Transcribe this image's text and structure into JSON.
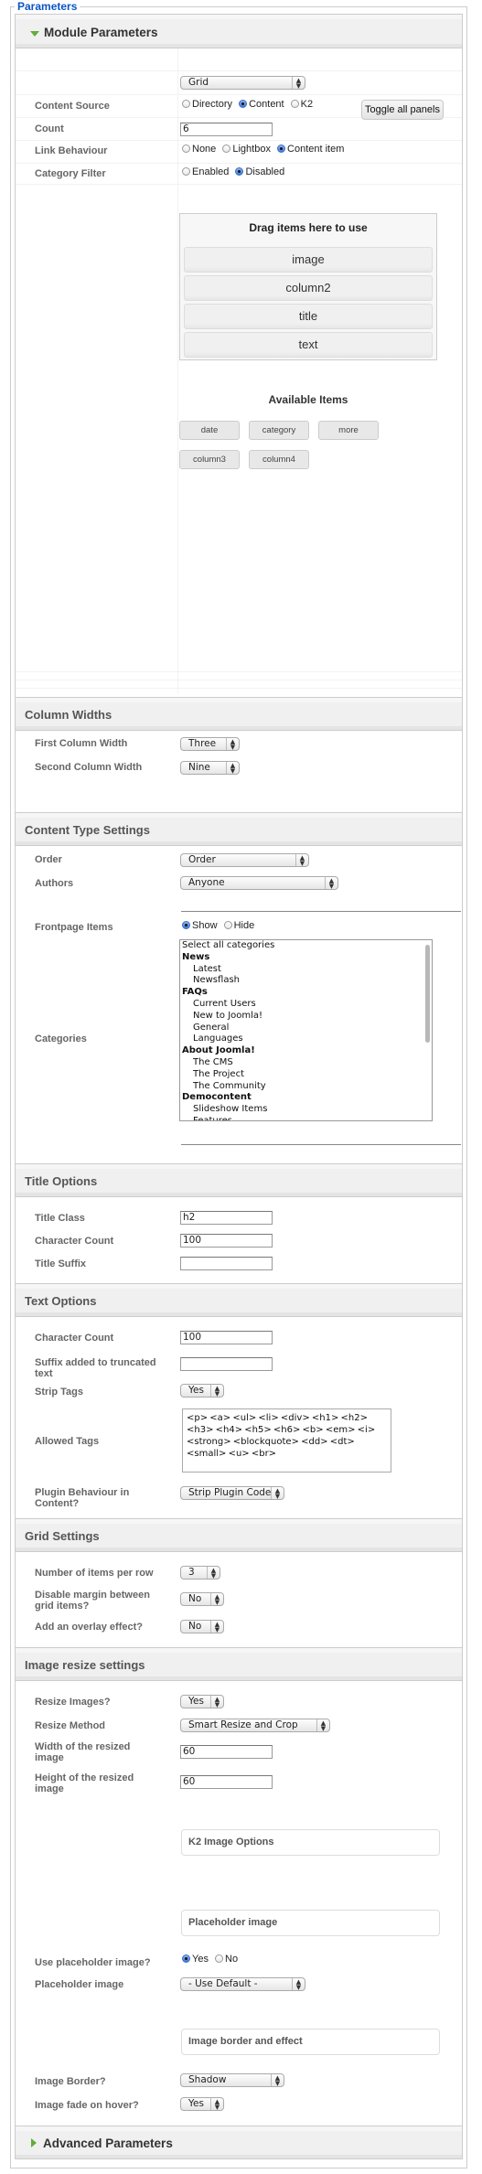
{
  "legend": "Parameters",
  "module_panel": {
    "title": "Module Parameters",
    "expanded": true,
    "layout_select": "Grid",
    "content_source": {
      "label": "Content Source",
      "options": [
        "Directory",
        "Content",
        "K2"
      ],
      "selected": "Content"
    },
    "toggle_button": "Toggle all panels",
    "count": {
      "label": "Count",
      "value": "6"
    },
    "link_behaviour": {
      "label": "Link Behaviour",
      "options": [
        "None",
        "Lightbox",
        "Content item"
      ],
      "selected": "Content item"
    },
    "category_filter": {
      "label": "Category Filter",
      "options": [
        "Enabled",
        "Disabled"
      ],
      "selected": "Disabled"
    },
    "dropzone": {
      "heading": "Drag items here to use",
      "items": [
        "image",
        "column2",
        "title",
        "text"
      ]
    },
    "available": {
      "heading": "Available Items",
      "items": [
        "date",
        "category",
        "more",
        "column3",
        "column4"
      ]
    }
  },
  "column_widths": {
    "title": "Column Widths",
    "first": {
      "label": "First Column Width",
      "value": "Three"
    },
    "second": {
      "label": "Second Column Width",
      "value": "Nine"
    }
  },
  "content_type": {
    "title": "Content Type Settings",
    "order": {
      "label": "Order",
      "value": "Order"
    },
    "authors": {
      "label": "Authors",
      "value": "Anyone"
    },
    "frontpage": {
      "label": "Frontpage Items",
      "options": [
        "Show",
        "Hide"
      ],
      "selected": "Show"
    },
    "categories": {
      "label": "Categories",
      "items": [
        {
          "text": "Select all categories",
          "type": "plain"
        },
        {
          "text": "News",
          "type": "bold"
        },
        {
          "text": "Latest",
          "type": "child"
        },
        {
          "text": "Newsflash",
          "type": "child"
        },
        {
          "text": "FAQs",
          "type": "bold"
        },
        {
          "text": "Current Users",
          "type": "child"
        },
        {
          "text": "New to Joomla!",
          "type": "child"
        },
        {
          "text": "General",
          "type": "child"
        },
        {
          "text": "Languages",
          "type": "child"
        },
        {
          "text": "About Joomla!",
          "type": "bold"
        },
        {
          "text": "The CMS",
          "type": "child"
        },
        {
          "text": "The Project",
          "type": "child"
        },
        {
          "text": "The Community",
          "type": "child"
        },
        {
          "text": "Democontent",
          "type": "bold"
        },
        {
          "text": "Slideshow Items",
          "type": "child"
        },
        {
          "text": "Features",
          "type": "child"
        }
      ]
    }
  },
  "title_options": {
    "title": "Title Options",
    "title_class": {
      "label": "Title Class",
      "value": "h2"
    },
    "char_count": {
      "label": "Character Count",
      "value": "100"
    },
    "suffix": {
      "label": "Title Suffix",
      "value": ""
    }
  },
  "text_options": {
    "title": "Text Options",
    "char_count": {
      "label": "Character Count",
      "value": "100"
    },
    "suffix": {
      "label": "Suffix added to truncated text",
      "value": ""
    },
    "strip_tags": {
      "label": "Strip Tags",
      "value": "Yes"
    },
    "allowed_tags": {
      "label": "Allowed Tags",
      "value": "<p> <a> <ul> <li> <div> <h1> <h2> <h3> <h4> <h5> <h6> <b> <em> <i> <strong> <blockquote> <dd> <dt> <small> <u> <br>"
    },
    "plugin": {
      "label": "Plugin Behaviour in Content?",
      "value": "Strip Plugin Code"
    }
  },
  "grid_settings": {
    "title": "Grid Settings",
    "per_row": {
      "label": "Number of items per row",
      "value": "3"
    },
    "disable_margin": {
      "label": "Disable margin between grid items?",
      "value": "No"
    },
    "overlay": {
      "label": "Add an overlay effect?",
      "value": "No"
    }
  },
  "image_resize": {
    "title": "Image resize settings",
    "resize": {
      "label": "Resize Images?",
      "value": "Yes"
    },
    "method": {
      "label": "Resize Method",
      "value": "Smart Resize and Crop"
    },
    "width": {
      "label": "Width of the resized image",
      "value": "60"
    },
    "height": {
      "label": "Height of the resized image",
      "value": "60"
    },
    "k2_box": "K2 Image Options",
    "placeholder_box": "Placeholder image",
    "use_placeholder": {
      "label": "Use placeholder image?",
      "options": [
        "Yes",
        "No"
      ],
      "selected": "Yes"
    },
    "placeholder": {
      "label": "Placeholder image",
      "value": "- Use Default -"
    },
    "border_box": "Image border and effect",
    "border": {
      "label": "Image Border?",
      "value": "Shadow"
    },
    "fade": {
      "label": "Image fade on hover?",
      "value": "Yes"
    }
  },
  "advanced_panel": {
    "title": "Advanced Parameters",
    "expanded": false
  },
  "colors": {
    "legend": "#0b55c4",
    "accent_triangle": "#5fae3a",
    "radio_on": "#3f7ad6"
  }
}
